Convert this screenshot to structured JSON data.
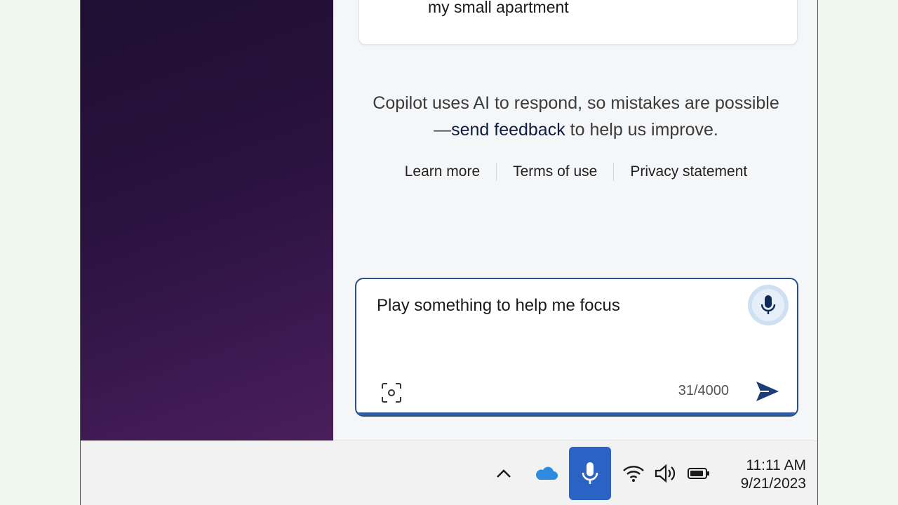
{
  "chat": {
    "previous_message_text": "my small apartment"
  },
  "disclaimer": {
    "prefix": "Copilot uses AI to respond, so mistakes are possible—",
    "feedback_link": "send feedback",
    "suffix": " to help us improve."
  },
  "links": {
    "learn_more": "Learn more",
    "terms": "Terms of use",
    "privacy": "Privacy statement"
  },
  "composer": {
    "input_value": "Play something to help me focus",
    "char_count": "31/4000",
    "mic_icon": "microphone-icon",
    "scan_icon": "screenshot-scan-icon",
    "send_icon": "send-arrow-icon"
  },
  "taskbar": {
    "time": "11:11 AM",
    "date": "9/21/2023",
    "icons": [
      "chevron-up-icon",
      "onedrive-cloud-icon",
      "microphone-icon",
      "wifi-icon",
      "volume-icon",
      "battery-icon"
    ]
  },
  "colors": {
    "accent": "#2a63c4",
    "input_border": "#2b4f86",
    "desktop": "#2a123f"
  }
}
